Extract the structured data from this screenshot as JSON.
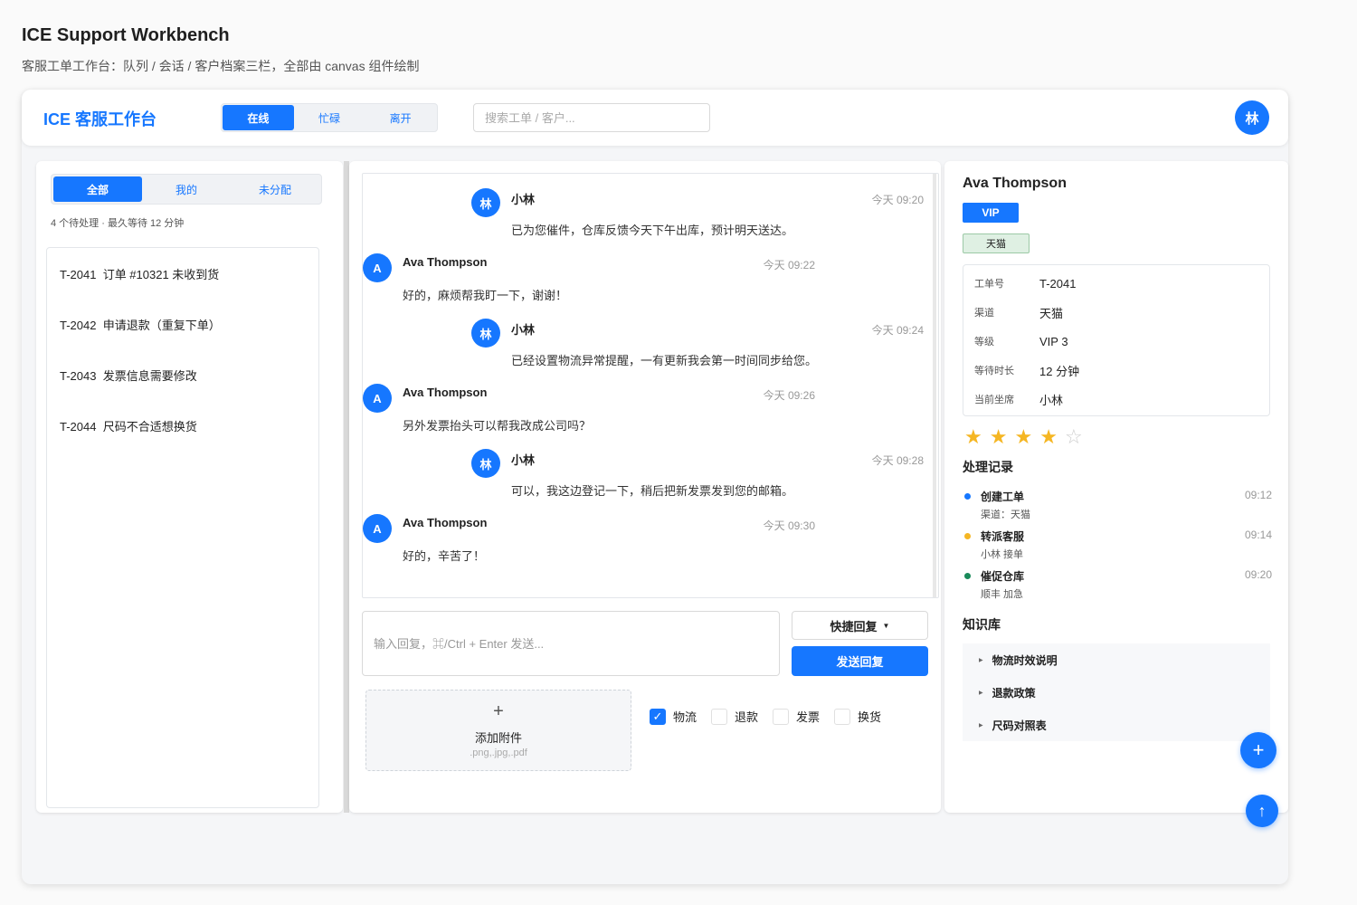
{
  "page": {
    "title": "ICE Support Workbench",
    "subtitle": "客服工单工作台：队列 / 会话 / 客户档案三栏，全部由 canvas 组件绘制"
  },
  "header": {
    "brand": "ICE 客服工作台",
    "status_options": [
      "在线",
      "忙碌",
      "离开"
    ],
    "status_selected": "在线",
    "search_placeholder": "搜索工单 / 客户...",
    "avatar_initial": "林"
  },
  "queue": {
    "filters": [
      "全部",
      "我的",
      "未分配"
    ],
    "filter_selected": "全部",
    "meta": "4 个待处理 · 最久等待 12 分钟",
    "tickets": [
      "T-2041  订单 #10321 未收到货",
      "T-2042  申请退款（重复下单）",
      "T-2043  发票信息需要修改",
      "T-2044  尺码不合适想换货"
    ]
  },
  "chat": {
    "messages": [
      {
        "role": "agent",
        "initial": "林",
        "name": "小林",
        "time": "今天 09:20",
        "text": "已为您催件，仓库反馈今天下午出库，预计明天送达。"
      },
      {
        "role": "customer",
        "initial": "A",
        "name": "Ava Thompson",
        "time": "今天 09:22",
        "text": "好的，麻烦帮我盯一下，谢谢！"
      },
      {
        "role": "agent",
        "initial": "林",
        "name": "小林",
        "time": "今天 09:24",
        "text": "已经设置物流异常提醒，一有更新我会第一时间同步给您。"
      },
      {
        "role": "customer",
        "initial": "A",
        "name": "Ava Thompson",
        "time": "今天 09:26",
        "text": "另外发票抬头可以帮我改成公司吗？"
      },
      {
        "role": "agent",
        "initial": "林",
        "name": "小林",
        "time": "今天 09:28",
        "text": "可以，我这边登记一下，稍后把新发票发到您的邮箱。"
      },
      {
        "role": "customer",
        "initial": "A",
        "name": "Ava Thompson",
        "time": "今天 09:30",
        "text": "好的，辛苦了！"
      }
    ],
    "reply_placeholder": "输入回复，⌘/Ctrl + Enter 发送...",
    "quick_reply_label": "快捷回复",
    "send_label": "发送回复",
    "attach": {
      "plus": "+",
      "label": "添加附件",
      "hint": ".png,.jpg,.pdf"
    },
    "tags": [
      {
        "label": "物流",
        "checked": true
      },
      {
        "label": "退款",
        "checked": false
      },
      {
        "label": "发票",
        "checked": false
      },
      {
        "label": "换货",
        "checked": false
      }
    ]
  },
  "profile": {
    "name": "Ava Thompson",
    "badge_vip": "VIP",
    "badge_channel": "天猫",
    "info": [
      {
        "key": "工单号",
        "value": "T-2041"
      },
      {
        "key": "渠道",
        "value": "天猫"
      },
      {
        "key": "等级",
        "value": "VIP 3"
      },
      {
        "key": "等待时长",
        "value": "12 分钟"
      },
      {
        "key": "当前坐席",
        "value": "小林"
      }
    ],
    "rating": 4,
    "rating_max": 5,
    "history_title": "处理记录",
    "history": [
      {
        "title": "创建工单",
        "sub": "渠道：天猫",
        "time": "09:12",
        "color": "#1677ff"
      },
      {
        "title": "转派客服",
        "sub": "小林 接单",
        "time": "09:14",
        "color": "#f5b623"
      },
      {
        "title": "催促仓库",
        "sub": "顺丰 加急",
        "time": "09:20",
        "color": "#1a8a5a"
      }
    ],
    "kb_title": "知识库",
    "kb_items": [
      "物流时效说明",
      "退款政策",
      "尺码对照表"
    ]
  },
  "fab": {
    "add_symbol": "+",
    "top_symbol": "↑"
  }
}
